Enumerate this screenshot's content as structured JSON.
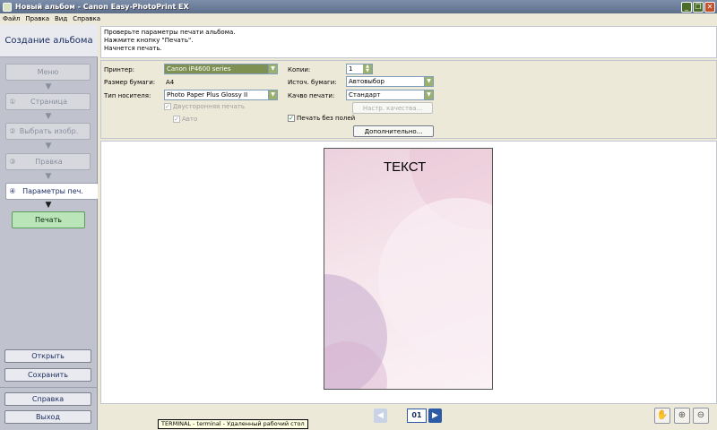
{
  "window": {
    "title": "Новый альбом - Canon Easy-PhotoPrint EX"
  },
  "menu": [
    "Файл",
    "Правка",
    "Вид",
    "Справка"
  ],
  "sidebar": {
    "title": "Создание альбома",
    "steps": [
      {
        "num": "",
        "label": "Меню"
      },
      {
        "num": "①",
        "label": "Страница"
      },
      {
        "num": "②",
        "label": "Выбрать изобр."
      },
      {
        "num": "③",
        "label": "Правка"
      },
      {
        "num": "④",
        "label": "Параметры печ."
      }
    ],
    "print_label": "Печать",
    "open_label": "Открыть",
    "save_label": "Сохранить",
    "help_label": "Справка",
    "exit_label": "Выход"
  },
  "instructions": [
    "Проверьте параметры печати альбома.",
    "Нажмите кнопку \"Печать\".",
    "Начнется печать."
  ],
  "settings": {
    "printer_label": "Принтер:",
    "printer_value": "Canon iP4600 series",
    "paper_size_label": "Размер бумаги:",
    "paper_size_value": "A4",
    "media_type_label": "Тип носителя:",
    "media_type_value": "Photo Paper Plus Glossy II",
    "duplex_label": "Двусторонняя печать",
    "auto_label": "Авто",
    "copies_label": "Копии:",
    "copies_value": "1",
    "paper_source_label": "Источ. бумаги:",
    "paper_source_value": "Автовыбор",
    "quality_label": "Качво печати:",
    "quality_value": "Стандарт",
    "quality_settings_label": "Настр. качества...",
    "borderless_label": "Печать без полей",
    "borderless_checked": true,
    "advanced_label": "Дополнительно..."
  },
  "preview": {
    "page_text": "ТЕКСТ"
  },
  "navigation": {
    "page_number": "01"
  },
  "tooltip": "TERMINAL - terminal - Удаленный рабочий стол",
  "colors": {
    "accent": "#2d5aa5",
    "print_button": "#b9e5b9",
    "selected_printer": "#7f9152"
  }
}
